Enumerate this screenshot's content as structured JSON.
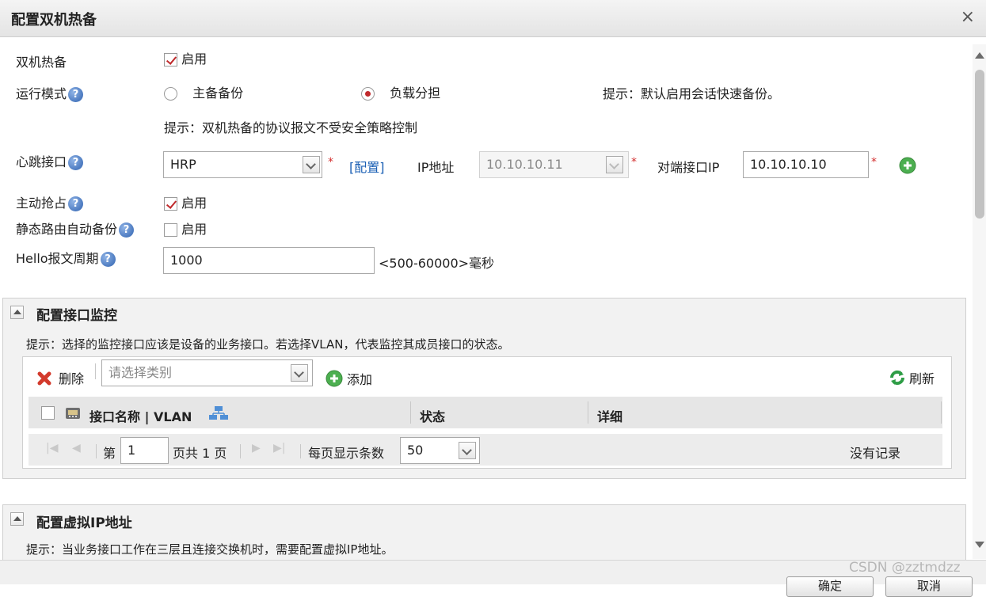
{
  "dialog": {
    "title": "配置双机热备",
    "close_glyph": "×"
  },
  "hot_standby": {
    "label": "双机热备",
    "checked": true,
    "option_label": "启用"
  },
  "run_mode": {
    "label": "运行模式",
    "help": "?",
    "options": [
      {
        "label": "主备备份",
        "selected": false
      },
      {
        "label": "负载分担",
        "selected": true
      }
    ],
    "hint": "提示：默认启用会话快速备份。"
  },
  "policy_hint": "提示：双机热备的协议报文不受安全策略控制",
  "heartbeat": {
    "label": "心跳接口",
    "help": "?",
    "interface_value": "HRP",
    "required": "*",
    "config_link": "[配置]",
    "ip_label": "IP地址",
    "ip_value": "10.10.10.11",
    "peer_label": "对端接口IP",
    "peer_value": "10.10.10.10"
  },
  "preempt": {
    "label": "主动抢占",
    "help": "?",
    "checked": true,
    "option_label": "启用"
  },
  "static_route_backup": {
    "label": "静态路由自动备份",
    "help": "?",
    "checked": false,
    "option_label": "启用"
  },
  "hello_period": {
    "label": "Hello报文周期",
    "help": "?",
    "value": "1000",
    "range": "<500-60000>毫秒"
  },
  "interface_monitor": {
    "title": "配置接口监控",
    "hint": "提示：选择的监控接口应该是设备的业务接口。若选择VLAN，代表监控其成员接口的状态。",
    "toolbar": {
      "delete": "删除",
      "category_placeholder": "请选择类别",
      "add": "添加",
      "refresh": "刷新"
    },
    "columns": [
      "接口名称 | VLAN",
      "状态",
      "详细"
    ],
    "pagination": {
      "page_prefix": "第",
      "page_value": "1",
      "page_suffix": "页共 1 页",
      "per_page_label": "每页显示条数",
      "per_page_value": "50",
      "empty_text": "没有记录"
    }
  },
  "virtual_ip": {
    "title": "配置虚拟IP地址",
    "hint": "提示：当业务接口工作在三层且连接交换机时，需要配置虚拟IP地址。"
  },
  "footer": {
    "ok_label": "确定",
    "cancel_label": "取消"
  },
  "watermark": "CSDN @zztmdzz",
  "colors": {
    "accent_red": "#c0292b",
    "link_blue": "#1a5fb4",
    "panel_bg": "#f2f2f2"
  }
}
